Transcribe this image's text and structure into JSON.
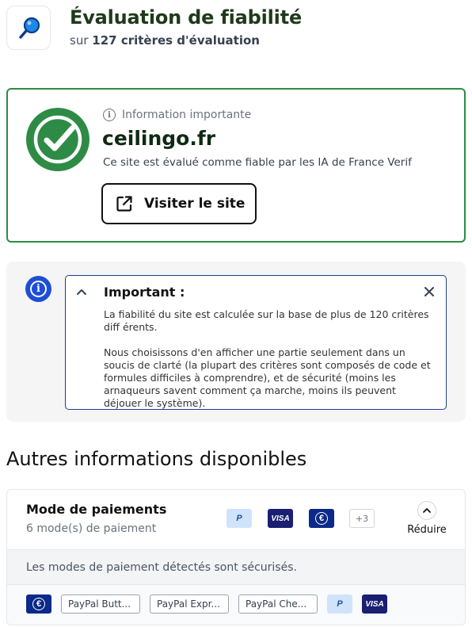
{
  "header": {
    "title": "Évaluation de fiabilité",
    "subtitle_prefix": "sur",
    "subtitle_count": "127 critères d'évaluation",
    "icon": "magnifier-icon"
  },
  "trust": {
    "info_label": "Information importante",
    "domain": "ceilingo.fr",
    "verdict": "Ce site est évalué comme fiable par les IA de France Verif",
    "visit_label": "Visiter le site",
    "status_color": "#2e8b46"
  },
  "important": {
    "title": "Important :",
    "paragraph1": "La fiabilité du site est calculée sur la base de plus de 120 critères diff érents.",
    "paragraph2": "Nous choisissons d'en afficher une partie seulement dans un soucis de clarté (la plupart des critères sont composés de code et formules difficiles à comprendre), et de sécurité (moins les arnaqueurs savent comment ça marche, moins ils peuvent déjouer le système).",
    "accent_color": "#1d4ed8"
  },
  "section": {
    "heading": "Autres informations disponibles"
  },
  "payments": {
    "title": "Mode de paiements",
    "subtitle": "6 mode(s) de paiement",
    "logos": [
      "P",
      "VISA",
      "€"
    ],
    "more_label": "+3",
    "reduce_label": "Réduire",
    "security_note": "Les modes de paiement détectés sont sécurisés.",
    "methods": {
      "euro": "€",
      "paypal_buttons": "PayPal Butt...",
      "paypal_express": "PayPal Expr...",
      "paypal_checkout": "PayPal Che...",
      "paypal_logo": "P",
      "visa_logo": "VISA"
    }
  }
}
